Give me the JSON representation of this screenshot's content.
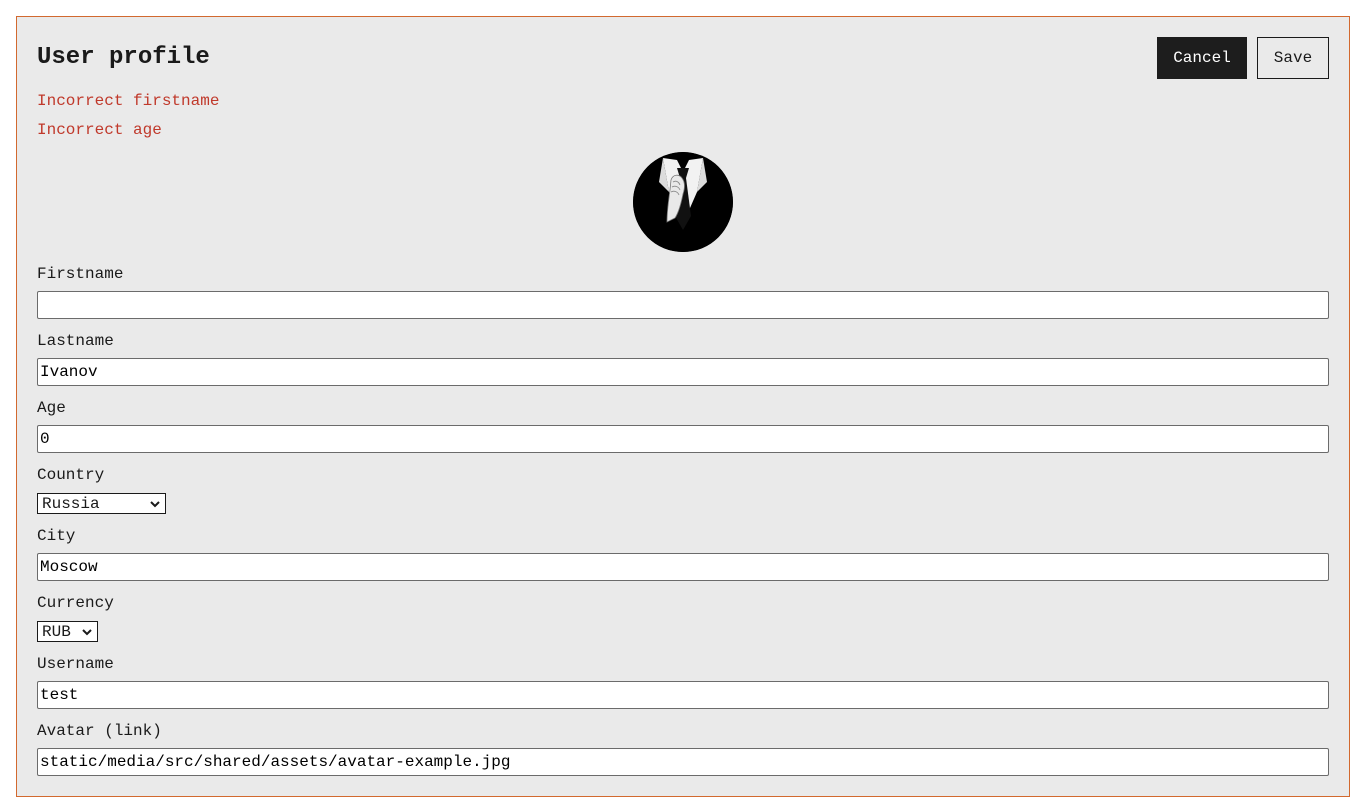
{
  "profile": {
    "title": "User profile",
    "cancel_label": "Cancel",
    "save_label": "Save",
    "errors": [
      "Incorrect firstname",
      "Incorrect age"
    ]
  },
  "fields": {
    "firstname": {
      "label": "Firstname",
      "value": ""
    },
    "lastname": {
      "label": "Lastname",
      "value": "Ivanov"
    },
    "age": {
      "label": "Age",
      "value": "0"
    },
    "country": {
      "label": "Country",
      "value": "Russia"
    },
    "city": {
      "label": "City",
      "value": "Moscow"
    },
    "currency": {
      "label": "Currency",
      "value": "RUB"
    },
    "username": {
      "label": "Username",
      "value": "test"
    },
    "avatar": {
      "label": "Avatar (link)",
      "value": "static/media/src/shared/assets/avatar-example.jpg"
    }
  },
  "colors": {
    "card_border": "#d2692f",
    "card_background": "#eaeaea",
    "error_text": "#c0392b",
    "primary_button": "#1d1d1d"
  },
  "icons": {
    "select_arrow": "chevron-down-icon",
    "avatar": "suit-and-tie-avatar"
  }
}
